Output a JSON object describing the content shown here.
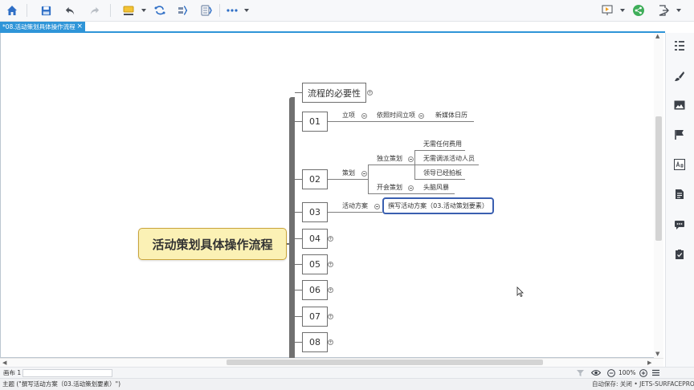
{
  "toolbar": {
    "icons": [
      "home-icon",
      "save-icon",
      "undo-icon",
      "redo-icon",
      "topic-style-icon",
      "relationship-icon",
      "summary-icon",
      "boundary-icon",
      "more-icon",
      "present-icon",
      "share-icon",
      "export-icon"
    ]
  },
  "tab": {
    "title": "*08.活动策划具体操作流程",
    "close": "×"
  },
  "mindmap": {
    "central": "活动策划具体操作流程",
    "top_node": "流程的必要性",
    "nodes": [
      {
        "label": "01"
      },
      {
        "label": "02"
      },
      {
        "label": "03"
      },
      {
        "label": "04"
      },
      {
        "label": "05"
      },
      {
        "label": "06"
      },
      {
        "label": "07"
      },
      {
        "label": "08"
      }
    ],
    "n01": {
      "topic": "立项",
      "child": "依照时间立项",
      "grandchild": "新媒体日历"
    },
    "n02": {
      "topic": "策划",
      "branch_a": "独立策划",
      "branch_a_children": [
        "无需任何费用",
        "无需调派活动人员",
        "领导已经拍板"
      ],
      "branch_b": "开会策划",
      "branch_b_child": "头脑风暴"
    },
    "n03": {
      "topic": "活动方案",
      "selected_child": "撰写活动方案（03.活动策划要素）"
    }
  },
  "statusbar": {
    "sheet": "画布 1",
    "zoom": "100%"
  },
  "bottombar": {
    "selection": "主题 (\"撰写活动方案（03.活动策划要素）\")",
    "autosave": "自动保存: 关闭",
    "device": "JETS-SURFACEPRO"
  },
  "colors": {
    "accent": "#2f95d8",
    "central_fill": "#fbf1b5",
    "selection": "#3a5fb0"
  }
}
